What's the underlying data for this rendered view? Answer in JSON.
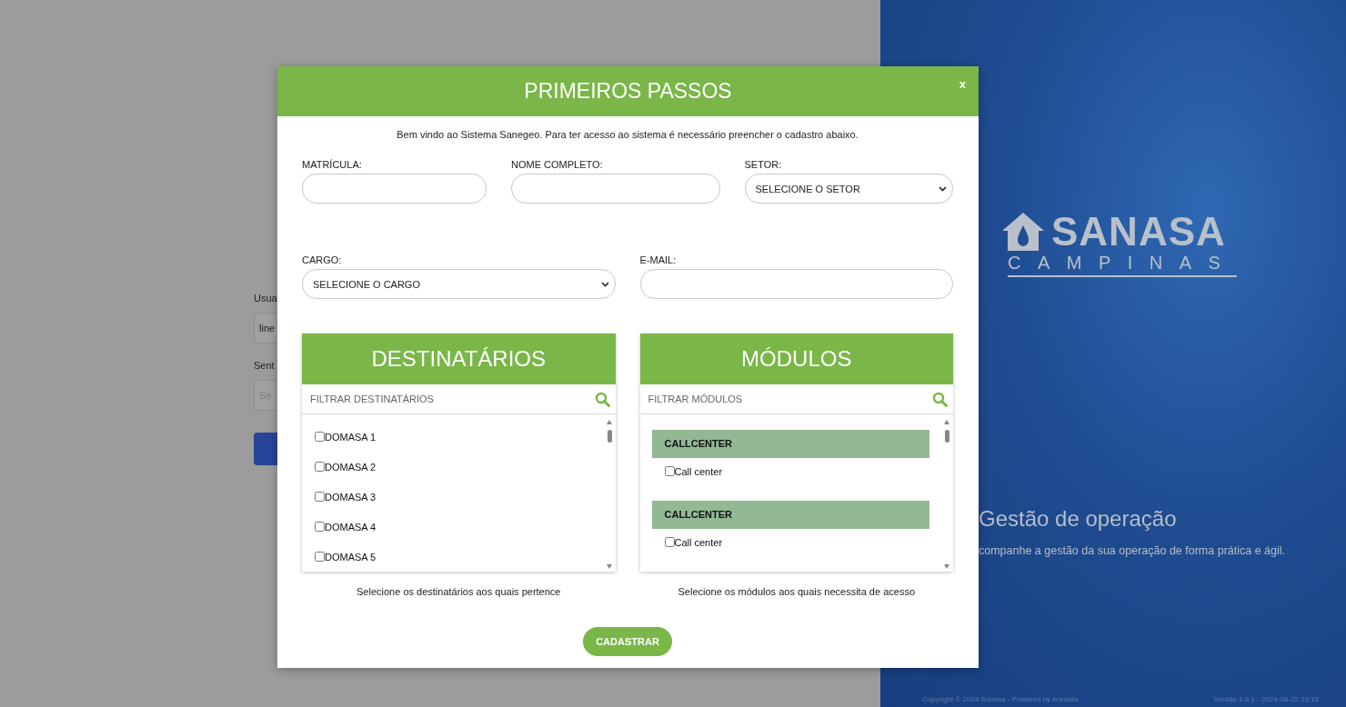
{
  "background_login": {
    "fields": [
      {
        "label": "Usua",
        "value": "line"
      },
      {
        "label": "Sent",
        "placeholder": "Se"
      }
    ]
  },
  "brand_panel": {
    "logo_name": "SANASA",
    "logo_subtitle": "CAMPINAS",
    "headline": "Gestão de operação",
    "tagline": "companhe a gestão da sua operação de forma prática e ágil.",
    "copyright": "Copyright © 2024 Sanasa - Powered by linedata",
    "version": "Versão 1.0.1 - 2024-08-22 19:15"
  },
  "modal": {
    "title": "PRIMEIROS PASSOS",
    "close": "x",
    "intro": "Bem vindo ao Sistema Sanegeo. Para ter acesso ao sistema é necessário preencher o cadastro abaixo.",
    "rows": [
      [
        {
          "kind": "text",
          "label": "MATRÍCULA:"
        },
        {
          "kind": "text",
          "label": "NOME COMPLETO:"
        },
        {
          "kind": "select",
          "label": "SETOR:",
          "value": "SELECIONE O SETOR"
        }
      ],
      [
        {
          "kind": "select",
          "label": "CARGO:",
          "value": "SELECIONE O CARGO"
        },
        {
          "kind": "text",
          "label": "E-MAIL:"
        }
      ]
    ],
    "lists": [
      {
        "kind": "flat",
        "title": "DESTINATÁRIOS",
        "filter_placeholder": "FILTRAR DESTINATÁRIOS",
        "hint": "Selecione os destinatários aos quais pertence",
        "items": [
          {
            "label": "DOMASA 1",
            "checked": false
          },
          {
            "label": "DOMASA 2",
            "checked": false
          },
          {
            "label": "DOMASA 3",
            "checked": false
          },
          {
            "label": "DOMASA 4",
            "checked": false
          },
          {
            "label": "DOMASA 5",
            "checked": false
          }
        ]
      },
      {
        "kind": "grouped",
        "title": "MÓDULOS",
        "filter_placeholder": "FILTRAR MÓDULOS",
        "hint": "Selecione os módulos aos quais necessita de acesso",
        "groups": [
          {
            "name": "CALLCENTER",
            "items": [
              {
                "label": "Call center",
                "checked": false
              }
            ]
          },
          {
            "name": "CALLCENTER",
            "items": [
              {
                "label": "Call center",
                "checked": false
              }
            ]
          }
        ]
      }
    ],
    "submit": "CADASTRAR"
  }
}
